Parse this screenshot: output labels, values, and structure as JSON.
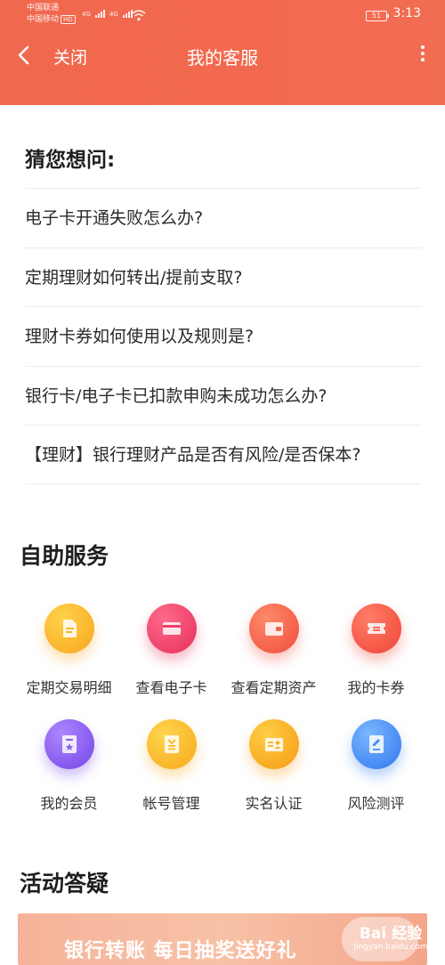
{
  "status_bar": {
    "carrier1": "中国联通",
    "carrier2": "中国移动",
    "hd": "HD",
    "net1": "4G",
    "net2": "4G",
    "battery": "51",
    "time": "3:13"
  },
  "nav": {
    "back_icon": "chevron-left-icon",
    "close_label": "关闭",
    "title": "我的客服",
    "more_icon": "more-vertical-icon"
  },
  "guess": {
    "title": "猜您想问:",
    "questions": [
      "电子卡开通失败怎么办?",
      "定期理财如何转出/提前支取?",
      "理财卡券如何使用以及规则是?",
      "银行卡/电子卡已扣款申购未成功怎么办?",
      "【理财】银行理财产品是否有风险/是否保本?"
    ]
  },
  "self_service": {
    "title": "自助服务",
    "items": [
      {
        "label": "定期交易明细",
        "icon": "document-icon",
        "color": "#f7b52a"
      },
      {
        "label": "查看电子卡",
        "icon": "card-icon",
        "color": "#ef3f6a"
      },
      {
        "label": "查看定期资产",
        "icon": "wallet-icon",
        "color": "#f5634a"
      },
      {
        "label": "我的卡券",
        "icon": "ticket-icon",
        "color": "#f5584a"
      },
      {
        "label": "我的会员",
        "icon": "member-badge-icon",
        "color": "#8b5cf0"
      },
      {
        "label": "帐号管理",
        "icon": "account-icon",
        "color": "#fbbd23"
      },
      {
        "label": "实名认证",
        "icon": "id-card-icon",
        "color": "#f9ad1f"
      },
      {
        "label": "风险测评",
        "icon": "assessment-icon",
        "color": "#3f8df7"
      }
    ]
  },
  "activity": {
    "title": "活动答疑",
    "banner_text": "银行转账 每日抽奖送好礼"
  },
  "watermark": {
    "main": "Bai 经验",
    "sub": "jingyan.baidu.com"
  }
}
